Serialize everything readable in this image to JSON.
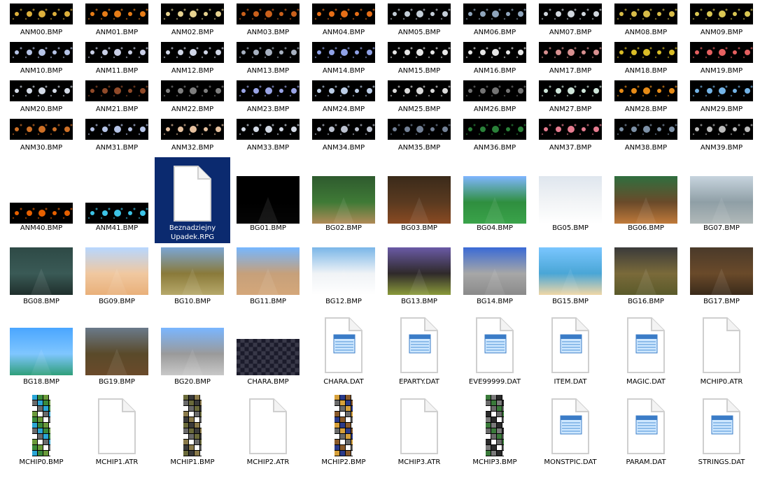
{
  "files": [
    {
      "name": "ANM00.BMP",
      "kind": "anim",
      "bg": "#000000",
      "accent": "#f5c342"
    },
    {
      "name": "ANM01.BMP",
      "kind": "anim",
      "bg": "#000000",
      "accent": "#ff8a1a"
    },
    {
      "name": "ANM02.BMP",
      "kind": "anim",
      "bg": "#000000",
      "accent": "#ffe9a0"
    },
    {
      "name": "ANM03.BMP",
      "kind": "anim",
      "bg": "#000000",
      "accent": "#e06a1e"
    },
    {
      "name": "ANM04.BMP",
      "kind": "anim",
      "bg": "#000000",
      "accent": "#ff7a1a"
    },
    {
      "name": "ANM05.BMP",
      "kind": "anim",
      "bg": "#000000",
      "accent": "#d9e4f0"
    },
    {
      "name": "ANM06.BMP",
      "kind": "anim",
      "bg": "#000000",
      "accent": "#9fb7d0"
    },
    {
      "name": "ANM07.BMP",
      "kind": "anim",
      "bg": "#000000",
      "accent": "#e8eef6"
    },
    {
      "name": "ANM08.BMP",
      "kind": "anim",
      "bg": "#000000",
      "accent": "#f0d050"
    },
    {
      "name": "ANM09.BMP",
      "kind": "anim",
      "bg": "#000000",
      "accent": "#f2dd5c"
    },
    {
      "name": "ANM10.BMP",
      "kind": "anim",
      "bg": "#000000",
      "accent": "#c9d8ff"
    },
    {
      "name": "ANM11.BMP",
      "kind": "anim",
      "bg": "#000000",
      "accent": "#dfe6ff"
    },
    {
      "name": "ANM12.BMP",
      "kind": "anim",
      "bg": "#000000",
      "accent": "#e6ecff"
    },
    {
      "name": "ANM13.BMP",
      "kind": "anim",
      "bg": "#000000",
      "accent": "#b9c4d6"
    },
    {
      "name": "ANM14.BMP",
      "kind": "anim",
      "bg": "#000000",
      "accent": "#9fb3ff"
    },
    {
      "name": "ANM15.BMP",
      "kind": "anim",
      "bg": "#000000",
      "accent": "#ffffff"
    },
    {
      "name": "ANM16.BMP",
      "kind": "anim",
      "bg": "#000000",
      "accent": "#ffffff"
    },
    {
      "name": "ANM17.BMP",
      "kind": "anim",
      "bg": "#000000",
      "accent": "#f0a0a0"
    },
    {
      "name": "ANM18.BMP",
      "kind": "anim",
      "bg": "#000000",
      "accent": "#f1d02a"
    },
    {
      "name": "ANM19.BMP",
      "kind": "anim",
      "bg": "#000000",
      "accent": "#ff6a6a"
    },
    {
      "name": "ANM20.BMP",
      "kind": "anim",
      "bg": "#000000",
      "accent": "#eaf2ff"
    },
    {
      "name": "ANM21.BMP",
      "kind": "anim",
      "bg": "#000000",
      "accent": "#a0522d"
    },
    {
      "name": "ANM22.BMP",
      "kind": "anim",
      "bg": "#000000",
      "accent": "#8c8c8c"
    },
    {
      "name": "ANM23.BMP",
      "kind": "anim",
      "bg": "#000000",
      "accent": "#aab6ff"
    },
    {
      "name": "ANM24.BMP",
      "kind": "anim",
      "bg": "#000000",
      "accent": "#cfe3ff"
    },
    {
      "name": "ANM25.BMP",
      "kind": "anim",
      "bg": "#000000",
      "accent": "#f2f2f2"
    },
    {
      "name": "ANM26.BMP",
      "kind": "anim",
      "bg": "#000000",
      "accent": "#7f7f7f"
    },
    {
      "name": "ANM27.BMP",
      "kind": "anim",
      "bg": "#000000",
      "accent": "#e6fff2"
    },
    {
      "name": "ANM28.BMP",
      "kind": "anim",
      "bg": "#000000",
      "accent": "#ff9a1a"
    },
    {
      "name": "ANM29.BMP",
      "kind": "anim",
      "bg": "#000000",
      "accent": "#7fc6ff"
    },
    {
      "name": "ANM30.BMP",
      "kind": "anim",
      "bg": "#000000",
      "accent": "#e47c2a"
    },
    {
      "name": "ANM31.BMP",
      "kind": "anim",
      "bg": "#000000",
      "accent": "#c9d8ff"
    },
    {
      "name": "ANM32.BMP",
      "kind": "anim",
      "bg": "#000000",
      "accent": "#ffd6b0"
    },
    {
      "name": "ANM33.BMP",
      "kind": "anim",
      "bg": "#000000",
      "accent": "#eaf2ff"
    },
    {
      "name": "ANM34.BMP",
      "kind": "anim",
      "bg": "#000000",
      "accent": "#cfd6e6"
    },
    {
      "name": "ANM35.BMP",
      "kind": "anim",
      "bg": "#000000",
      "accent": "#7f8fa6"
    },
    {
      "name": "ANM36.BMP",
      "kind": "anim",
      "bg": "#000000",
      "accent": "#2f8f3f"
    },
    {
      "name": "ANM37.BMP",
      "kind": "anim",
      "bg": "#000000",
      "accent": "#ff8aa0"
    },
    {
      "name": "ANM38.BMP",
      "kind": "anim",
      "bg": "#000000",
      "accent": "#8aa0b8"
    },
    {
      "name": "ANM39.BMP",
      "kind": "anim",
      "bg": "#000000",
      "accent": "#d0d0d0"
    },
    {
      "name": "ANM40.BMP",
      "kind": "anim",
      "bg": "#000000",
      "accent": "#ff6a00"
    },
    {
      "name": "ANM41.BMP",
      "kind": "anim",
      "bg": "#000000",
      "accent": "#43d8ff"
    },
    {
      "name": "Beznadziejny Upadek.RPG",
      "kind": "blank",
      "selected": true
    },
    {
      "name": "BG01.BMP",
      "kind": "bg",
      "top": "#000000",
      "mid": "#000000",
      "bottom": "#050505"
    },
    {
      "name": "BG02.BMP",
      "kind": "bg",
      "top": "#2e5a2e",
      "mid": "#3f7a36",
      "bottom": "#b08a57"
    },
    {
      "name": "BG03.BMP",
      "kind": "bg",
      "top": "#3a2a1a",
      "mid": "#5a3a20",
      "bottom": "#8a4a22"
    },
    {
      "name": "BG04.BMP",
      "kind": "bg",
      "top": "#7fb6ff",
      "mid": "#2f8f3f",
      "bottom": "#3aa34a"
    },
    {
      "name": "BG05.BMP",
      "kind": "bg",
      "top": "#dfe6ee",
      "mid": "#f2f4f6",
      "bottom": "#ffffff"
    },
    {
      "name": "BG06.BMP",
      "kind": "bg",
      "top": "#2f6f3f",
      "mid": "#6a4a2a",
      "bottom": "#c07a3a"
    },
    {
      "name": "BG07.BMP",
      "kind": "bg",
      "top": "#c7d4de",
      "mid": "#8f9fa6",
      "bottom": "#b0b8b8"
    },
    {
      "name": "BG08.BMP",
      "kind": "bg",
      "top": "#2e4a46",
      "mid": "#3a5a56",
      "bottom": "#1f2f2c"
    },
    {
      "name": "BG09.BMP",
      "kind": "bg",
      "top": "#b7d7ff",
      "mid": "#f0c8a0",
      "bottom": "#e9b07a"
    },
    {
      "name": "BG10.BMP",
      "kind": "bg",
      "top": "#7aa6d6",
      "mid": "#8a7a3a",
      "bottom": "#b6a86a"
    },
    {
      "name": "BG11.BMP",
      "kind": "bg",
      "top": "#76b7ff",
      "mid": "#c6a07a",
      "bottom": "#d4a77a"
    },
    {
      "name": "BG12.BMP",
      "kind": "bg",
      "top": "#7ab6e8",
      "mid": "#f0f3f6",
      "bottom": "#ffffff"
    },
    {
      "name": "BG13.BMP",
      "kind": "bg",
      "top": "#6a5aa6",
      "mid": "#2f2a2a",
      "bottom": "#8a9a3a"
    },
    {
      "name": "BG14.BMP",
      "kind": "bg",
      "top": "#3a6ad6",
      "mid": "#a7a7a7",
      "bottom": "#8a8a8a"
    },
    {
      "name": "BG15.BMP",
      "kind": "bg",
      "top": "#7ac6ff",
      "mid": "#4aa6d6",
      "bottom": "#f0d7a6"
    },
    {
      "name": "BG16.BMP",
      "kind": "bg",
      "top": "#3a3a3a",
      "mid": "#7a6a3a",
      "bottom": "#5a5a2a"
    },
    {
      "name": "BG17.BMP",
      "kind": "bg",
      "top": "#4a3a2a",
      "mid": "#6a4a2a",
      "bottom": "#3a2a1a"
    },
    {
      "name": "BG18.BMP",
      "kind": "bg",
      "top": "#4aa6ff",
      "mid": "#7fc6ff",
      "bottom": "#2f9f7a"
    },
    {
      "name": "BG19.BMP",
      "kind": "bg",
      "top": "#6a7a8a",
      "mid": "#5a4a2a",
      "bottom": "#6a4a2a"
    },
    {
      "name": "BG20.BMP",
      "kind": "bg",
      "top": "#7ab6ff",
      "mid": "#9a9a9a",
      "bottom": "#c8c8c8"
    },
    {
      "name": "CHARA.BMP",
      "kind": "sheet",
      "top": "#1a1a2a",
      "mid": "#3a3a4a",
      "bottom": "#2a2a3a"
    },
    {
      "name": "CHARA.DAT",
      "kind": "notepad"
    },
    {
      "name": "EPARTY.DAT",
      "kind": "notepad"
    },
    {
      "name": "EVE99999.DAT",
      "kind": "notepad"
    },
    {
      "name": "ITEM.DAT",
      "kind": "notepad"
    },
    {
      "name": "MAGIC.DAT",
      "kind": "notepad"
    },
    {
      "name": "MCHIP0.ATR",
      "kind": "blank"
    },
    {
      "name": "MCHIP0.BMP",
      "kind": "tiles",
      "top": "#2aa6d6",
      "mid": "#3a8a3a",
      "bottom": "#6a9a3a"
    },
    {
      "name": "MCHIP1.ATR",
      "kind": "blank"
    },
    {
      "name": "MCHIP1.BMP",
      "kind": "tiles",
      "top": "#6a6a3a",
      "mid": "#3a3a3a",
      "bottom": "#8a7a4a"
    },
    {
      "name": "MCHIP2.ATR",
      "kind": "blank"
    },
    {
      "name": "MCHIP2.BMP",
      "kind": "tiles",
      "top": "#d6a03a",
      "mid": "#2a3a8a",
      "bottom": "#8a5a2a"
    },
    {
      "name": "MCHIP3.ATR",
      "kind": "blank"
    },
    {
      "name": "MCHIP3.BMP",
      "kind": "tiles",
      "top": "#3a7a3a",
      "mid": "#7a7a7a",
      "bottom": "#2a2a2a"
    },
    {
      "name": "MONSTPIC.DAT",
      "kind": "notepad"
    },
    {
      "name": "PARAM.DAT",
      "kind": "notepad"
    },
    {
      "name": "STRINGS.DAT",
      "kind": "notepad"
    }
  ]
}
